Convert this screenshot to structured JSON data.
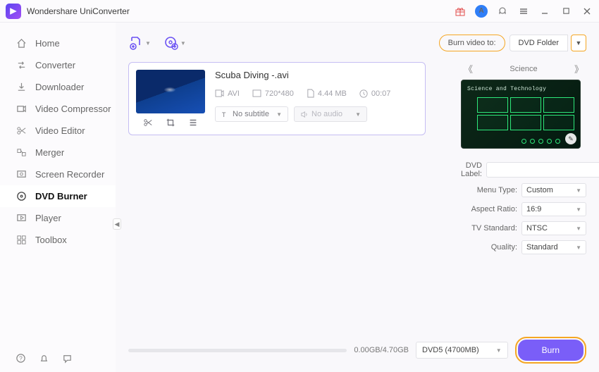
{
  "app": {
    "title": "Wondershare UniConverter"
  },
  "sidebar": {
    "items": [
      {
        "label": "Home"
      },
      {
        "label": "Converter"
      },
      {
        "label": "Downloader"
      },
      {
        "label": "Video Compressor"
      },
      {
        "label": "Video Editor"
      },
      {
        "label": "Merger"
      },
      {
        "label": "Screen Recorder"
      },
      {
        "label": "DVD Burner"
      },
      {
        "label": "Player"
      },
      {
        "label": "Toolbox"
      }
    ]
  },
  "toolbar": {
    "burn_to_label": "Burn video to:",
    "burn_to_value": "DVD Folder"
  },
  "file": {
    "name": "Scuba Diving -.avi",
    "format": "AVI",
    "resolution": "720*480",
    "size": "4.44 MB",
    "duration": "00:07",
    "subtitle_label": "No subtitle",
    "audio_label": "No audio"
  },
  "theme": {
    "name": "Science",
    "preview_title": "Science and Technology"
  },
  "settings": {
    "dvd_label_label": "DVD Label:",
    "dvd_label_value": "",
    "menu_type_label": "Menu Type:",
    "menu_type_value": "Custom",
    "aspect_label": "Aspect Ratio:",
    "aspect_value": "16:9",
    "tv_label": "TV Standard:",
    "tv_value": "NTSC",
    "quality_label": "Quality:",
    "quality_value": "Standard"
  },
  "footer": {
    "progress_text": "0.00GB/4.70GB",
    "disc_value": "DVD5 (4700MB)",
    "burn_label": "Burn"
  }
}
